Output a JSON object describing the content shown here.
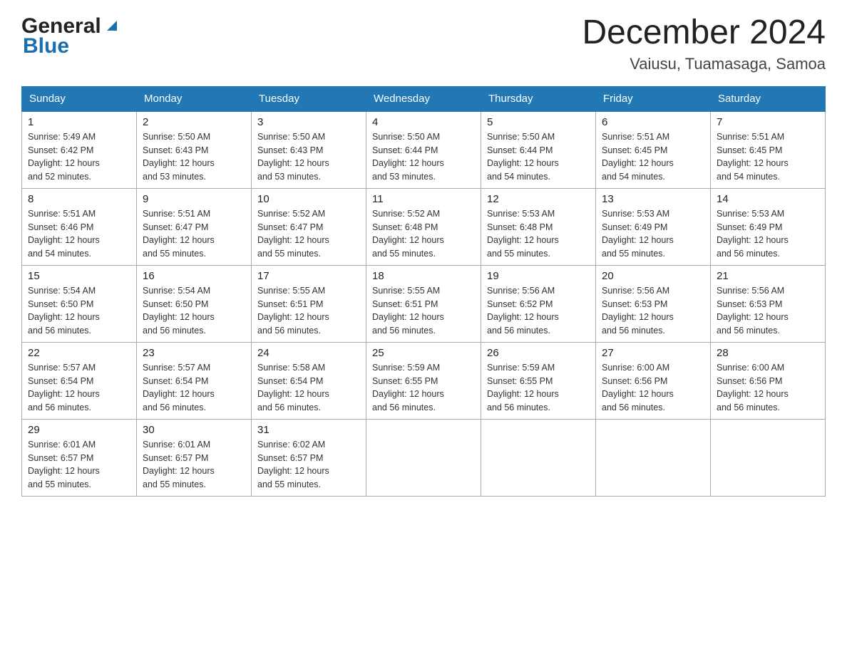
{
  "header": {
    "logo_general": "General",
    "logo_blue": "Blue",
    "month_title": "December 2024",
    "location": "Vaiusu, Tuamasaga, Samoa"
  },
  "days_of_week": [
    "Sunday",
    "Monday",
    "Tuesday",
    "Wednesday",
    "Thursday",
    "Friday",
    "Saturday"
  ],
  "weeks": [
    [
      {
        "day": "1",
        "sunrise": "5:49 AM",
        "sunset": "6:42 PM",
        "daylight": "12 hours and 52 minutes."
      },
      {
        "day": "2",
        "sunrise": "5:50 AM",
        "sunset": "6:43 PM",
        "daylight": "12 hours and 53 minutes."
      },
      {
        "day": "3",
        "sunrise": "5:50 AM",
        "sunset": "6:43 PM",
        "daylight": "12 hours and 53 minutes."
      },
      {
        "day": "4",
        "sunrise": "5:50 AM",
        "sunset": "6:44 PM",
        "daylight": "12 hours and 53 minutes."
      },
      {
        "day": "5",
        "sunrise": "5:50 AM",
        "sunset": "6:44 PM",
        "daylight": "12 hours and 54 minutes."
      },
      {
        "day": "6",
        "sunrise": "5:51 AM",
        "sunset": "6:45 PM",
        "daylight": "12 hours and 54 minutes."
      },
      {
        "day": "7",
        "sunrise": "5:51 AM",
        "sunset": "6:45 PM",
        "daylight": "12 hours and 54 minutes."
      }
    ],
    [
      {
        "day": "8",
        "sunrise": "5:51 AM",
        "sunset": "6:46 PM",
        "daylight": "12 hours and 54 minutes."
      },
      {
        "day": "9",
        "sunrise": "5:51 AM",
        "sunset": "6:47 PM",
        "daylight": "12 hours and 55 minutes."
      },
      {
        "day": "10",
        "sunrise": "5:52 AM",
        "sunset": "6:47 PM",
        "daylight": "12 hours and 55 minutes."
      },
      {
        "day": "11",
        "sunrise": "5:52 AM",
        "sunset": "6:48 PM",
        "daylight": "12 hours and 55 minutes."
      },
      {
        "day": "12",
        "sunrise": "5:53 AM",
        "sunset": "6:48 PM",
        "daylight": "12 hours and 55 minutes."
      },
      {
        "day": "13",
        "sunrise": "5:53 AM",
        "sunset": "6:49 PM",
        "daylight": "12 hours and 55 minutes."
      },
      {
        "day": "14",
        "sunrise": "5:53 AM",
        "sunset": "6:49 PM",
        "daylight": "12 hours and 56 minutes."
      }
    ],
    [
      {
        "day": "15",
        "sunrise": "5:54 AM",
        "sunset": "6:50 PM",
        "daylight": "12 hours and 56 minutes."
      },
      {
        "day": "16",
        "sunrise": "5:54 AM",
        "sunset": "6:50 PM",
        "daylight": "12 hours and 56 minutes."
      },
      {
        "day": "17",
        "sunrise": "5:55 AM",
        "sunset": "6:51 PM",
        "daylight": "12 hours and 56 minutes."
      },
      {
        "day": "18",
        "sunrise": "5:55 AM",
        "sunset": "6:51 PM",
        "daylight": "12 hours and 56 minutes."
      },
      {
        "day": "19",
        "sunrise": "5:56 AM",
        "sunset": "6:52 PM",
        "daylight": "12 hours and 56 minutes."
      },
      {
        "day": "20",
        "sunrise": "5:56 AM",
        "sunset": "6:53 PM",
        "daylight": "12 hours and 56 minutes."
      },
      {
        "day": "21",
        "sunrise": "5:56 AM",
        "sunset": "6:53 PM",
        "daylight": "12 hours and 56 minutes."
      }
    ],
    [
      {
        "day": "22",
        "sunrise": "5:57 AM",
        "sunset": "6:54 PM",
        "daylight": "12 hours and 56 minutes."
      },
      {
        "day": "23",
        "sunrise": "5:57 AM",
        "sunset": "6:54 PM",
        "daylight": "12 hours and 56 minutes."
      },
      {
        "day": "24",
        "sunrise": "5:58 AM",
        "sunset": "6:54 PM",
        "daylight": "12 hours and 56 minutes."
      },
      {
        "day": "25",
        "sunrise": "5:59 AM",
        "sunset": "6:55 PM",
        "daylight": "12 hours and 56 minutes."
      },
      {
        "day": "26",
        "sunrise": "5:59 AM",
        "sunset": "6:55 PM",
        "daylight": "12 hours and 56 minutes."
      },
      {
        "day": "27",
        "sunrise": "6:00 AM",
        "sunset": "6:56 PM",
        "daylight": "12 hours and 56 minutes."
      },
      {
        "day": "28",
        "sunrise": "6:00 AM",
        "sunset": "6:56 PM",
        "daylight": "12 hours and 56 minutes."
      }
    ],
    [
      {
        "day": "29",
        "sunrise": "6:01 AM",
        "sunset": "6:57 PM",
        "daylight": "12 hours and 55 minutes."
      },
      {
        "day": "30",
        "sunrise": "6:01 AM",
        "sunset": "6:57 PM",
        "daylight": "12 hours and 55 minutes."
      },
      {
        "day": "31",
        "sunrise": "6:02 AM",
        "sunset": "6:57 PM",
        "daylight": "12 hours and 55 minutes."
      },
      null,
      null,
      null,
      null
    ]
  ],
  "labels": {
    "sunrise": "Sunrise:",
    "sunset": "Sunset:",
    "daylight": "Daylight:"
  }
}
